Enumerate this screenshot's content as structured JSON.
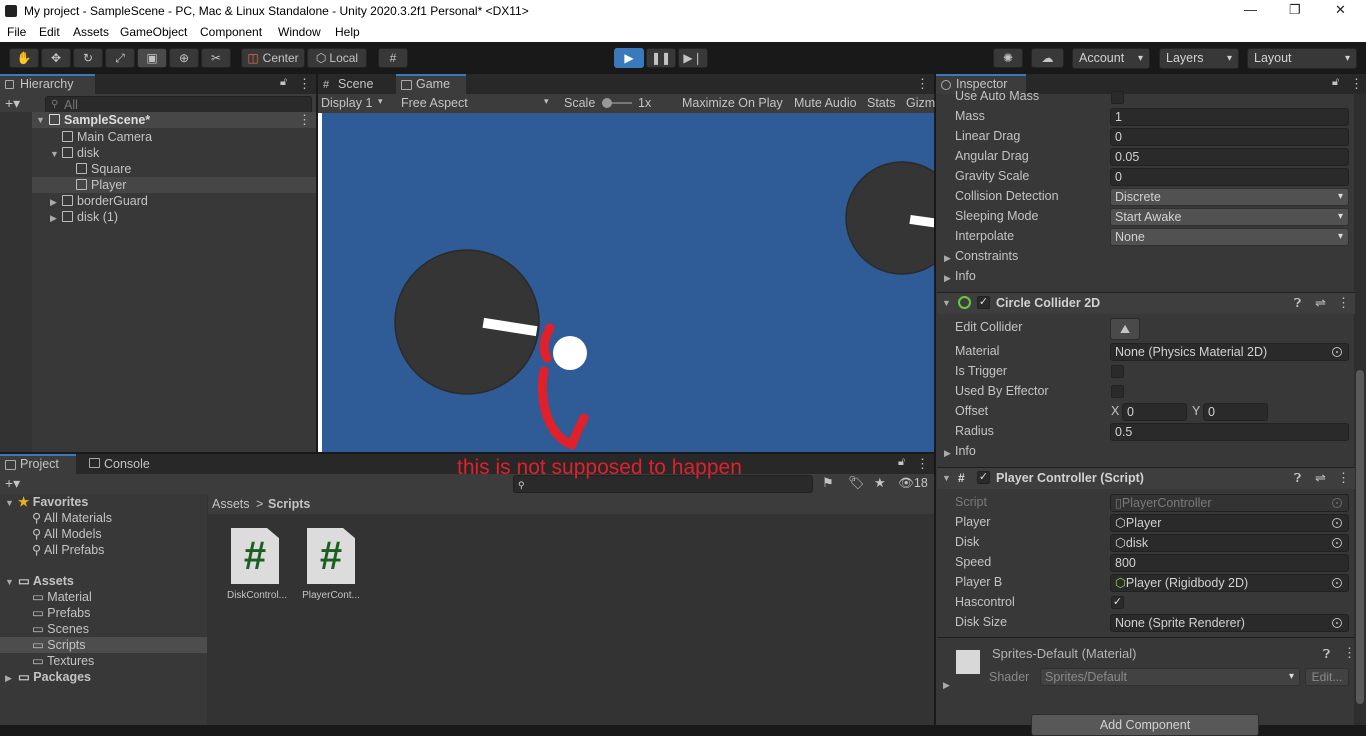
{
  "window": {
    "title": "My project - SampleScene - PC, Mac & Linux Standalone - Unity 2020.3.2f1 Personal* <DX11>",
    "min_icon": "minimize-icon",
    "max_icon": "restore-icon",
    "close_glyph": "✕"
  },
  "menu": [
    "File",
    "Edit",
    "Assets",
    "GameObject",
    "Component",
    "Window",
    "Help"
  ],
  "toolbar": {
    "pivot": "Center",
    "space": "Local",
    "account": "Account",
    "layers": "Layers",
    "layout": "Layout"
  },
  "hierarchy": {
    "tab": "Hierarchy",
    "search_placeholder": "All",
    "scene": "SampleScene*",
    "items": [
      {
        "label": "Main Camera"
      },
      {
        "label": "disk"
      },
      {
        "label": "Square"
      },
      {
        "label": "Player"
      },
      {
        "label": "borderGuard"
      },
      {
        "label": "disk (1)"
      }
    ]
  },
  "game_view": {
    "tabs": {
      "scene": "Scene",
      "game": "Game"
    },
    "display": "Display 1",
    "aspect": "Free Aspect",
    "scale_label": "Scale",
    "scale_value": "1x",
    "maximize": "Maximize On Play",
    "mute": "Mute Audio",
    "stats": "Stats",
    "gizmos": "Gizm",
    "background_color": "#2f5b96"
  },
  "annotation": {
    "text": "this is not supposed to happen",
    "color": "#e0202a"
  },
  "project": {
    "tabs": {
      "project": "Project",
      "console": "Console"
    },
    "favorites": {
      "label": "Favorites",
      "items": [
        "All Materials",
        "All Models",
        "All Prefabs"
      ]
    },
    "assets": {
      "label": "Assets",
      "items": [
        "Material",
        "Prefabs",
        "Scenes",
        "Scripts",
        "Textures"
      ]
    },
    "packages": "Packages",
    "hidden_count": "18",
    "breadcrumb": {
      "root": "Assets",
      "current": "Scripts"
    },
    "files": [
      {
        "name": "DiskControl...",
        "glyph": "#"
      },
      {
        "name": "PlayerCont...",
        "glyph": "#"
      }
    ]
  },
  "inspector": {
    "tab": "Inspector",
    "rigidbody": [
      {
        "label": "Use Auto Mass",
        "type": "check",
        "value": ""
      },
      {
        "label": "Mass",
        "type": "field",
        "value": "1"
      },
      {
        "label": "Linear Drag",
        "type": "field",
        "value": "0"
      },
      {
        "label": "Angular Drag",
        "type": "field",
        "value": "0.05"
      },
      {
        "label": "Gravity Scale",
        "type": "field",
        "value": "0"
      },
      {
        "label": "Collision Detection",
        "type": "drop",
        "value": "Discrete"
      },
      {
        "label": "Sleeping Mode",
        "type": "drop",
        "value": "Start Awake"
      },
      {
        "label": "Interpolate",
        "type": "drop",
        "value": "None"
      }
    ],
    "constraints": "Constraints",
    "info": "Info",
    "circle_collider": {
      "title": "Circle Collider 2D",
      "edit_collider": "Edit Collider",
      "material_label": "Material",
      "material_value": "None (Physics Material 2D)",
      "is_trigger": "Is Trigger",
      "used_by_effector": "Used By Effector",
      "offset_label": "Offset",
      "offset_x_label": "X",
      "offset_x": "0",
      "offset_y_label": "Y",
      "offset_y": "0",
      "radius_label": "Radius",
      "radius": "0.5",
      "info": "Info"
    },
    "player_controller": {
      "title": "Player Controller (Script)",
      "fields": [
        {
          "label": "Script",
          "value": "PlayerController"
        },
        {
          "label": "Player",
          "value": "Player"
        },
        {
          "label": "Disk",
          "value": "disk"
        },
        {
          "label": "Speed",
          "value": "800"
        },
        {
          "label": "Player B",
          "value": "Player (Rigidbody 2D)"
        },
        {
          "label": "Hascontrol",
          "value": "✓"
        },
        {
          "label": "Disk Size",
          "value": "None (Sprite Renderer)"
        }
      ]
    },
    "material": {
      "name": "Sprites-Default (Material)",
      "shader_label": "Shader",
      "shader_value": "Sprites/Default",
      "edit": "Edit..."
    },
    "add_component": "Add Component"
  }
}
